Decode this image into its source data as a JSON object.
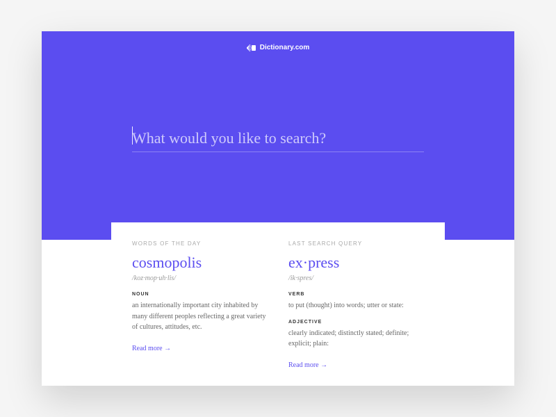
{
  "brand": {
    "name": "Dictionary.com"
  },
  "search": {
    "placeholder": "What would you like to search?",
    "value": ""
  },
  "cards": {
    "left": {
      "label": "WORDS OF THE DAY",
      "word": "cosmopolis",
      "pronunciation": "/koz·mop·uh·lis/",
      "pos1": "NOUN",
      "def1": "an internationally important city inhabited by many different peoples reflecting a great variety of cultures, attitudes, etc.",
      "readmore": "Read more →"
    },
    "right": {
      "label": "LAST SEARCH QUERY",
      "word": "ex·press",
      "pronunciation": "/ik·spres/",
      "pos1": "VERB",
      "def1": "to put (thought) into words; utter or state:",
      "pos2": "ADJECTIVE",
      "def2": "clearly indicated; distinctly stated; definite; explicit; plain:",
      "readmore": "Read more →"
    }
  }
}
